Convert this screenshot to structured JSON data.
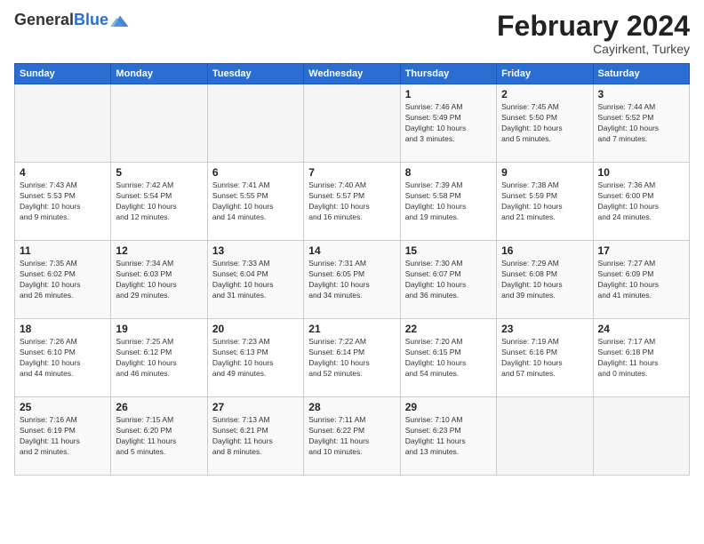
{
  "header": {
    "logo_general": "General",
    "logo_blue": "Blue",
    "month_title": "February 2024",
    "subtitle": "Cayirkent, Turkey"
  },
  "weekdays": [
    "Sunday",
    "Monday",
    "Tuesday",
    "Wednesday",
    "Thursday",
    "Friday",
    "Saturday"
  ],
  "rows": [
    [
      {
        "day": "",
        "info": ""
      },
      {
        "day": "",
        "info": ""
      },
      {
        "day": "",
        "info": ""
      },
      {
        "day": "",
        "info": ""
      },
      {
        "day": "1",
        "info": "Sunrise: 7:46 AM\nSunset: 5:49 PM\nDaylight: 10 hours\nand 3 minutes."
      },
      {
        "day": "2",
        "info": "Sunrise: 7:45 AM\nSunset: 5:50 PM\nDaylight: 10 hours\nand 5 minutes."
      },
      {
        "day": "3",
        "info": "Sunrise: 7:44 AM\nSunset: 5:52 PM\nDaylight: 10 hours\nand 7 minutes."
      }
    ],
    [
      {
        "day": "4",
        "info": "Sunrise: 7:43 AM\nSunset: 5:53 PM\nDaylight: 10 hours\nand 9 minutes."
      },
      {
        "day": "5",
        "info": "Sunrise: 7:42 AM\nSunset: 5:54 PM\nDaylight: 10 hours\nand 12 minutes."
      },
      {
        "day": "6",
        "info": "Sunrise: 7:41 AM\nSunset: 5:55 PM\nDaylight: 10 hours\nand 14 minutes."
      },
      {
        "day": "7",
        "info": "Sunrise: 7:40 AM\nSunset: 5:57 PM\nDaylight: 10 hours\nand 16 minutes."
      },
      {
        "day": "8",
        "info": "Sunrise: 7:39 AM\nSunset: 5:58 PM\nDaylight: 10 hours\nand 19 minutes."
      },
      {
        "day": "9",
        "info": "Sunrise: 7:38 AM\nSunset: 5:59 PM\nDaylight: 10 hours\nand 21 minutes."
      },
      {
        "day": "10",
        "info": "Sunrise: 7:36 AM\nSunset: 6:00 PM\nDaylight: 10 hours\nand 24 minutes."
      }
    ],
    [
      {
        "day": "11",
        "info": "Sunrise: 7:35 AM\nSunset: 6:02 PM\nDaylight: 10 hours\nand 26 minutes."
      },
      {
        "day": "12",
        "info": "Sunrise: 7:34 AM\nSunset: 6:03 PM\nDaylight: 10 hours\nand 29 minutes."
      },
      {
        "day": "13",
        "info": "Sunrise: 7:33 AM\nSunset: 6:04 PM\nDaylight: 10 hours\nand 31 minutes."
      },
      {
        "day": "14",
        "info": "Sunrise: 7:31 AM\nSunset: 6:05 PM\nDaylight: 10 hours\nand 34 minutes."
      },
      {
        "day": "15",
        "info": "Sunrise: 7:30 AM\nSunset: 6:07 PM\nDaylight: 10 hours\nand 36 minutes."
      },
      {
        "day": "16",
        "info": "Sunrise: 7:29 AM\nSunset: 6:08 PM\nDaylight: 10 hours\nand 39 minutes."
      },
      {
        "day": "17",
        "info": "Sunrise: 7:27 AM\nSunset: 6:09 PM\nDaylight: 10 hours\nand 41 minutes."
      }
    ],
    [
      {
        "day": "18",
        "info": "Sunrise: 7:26 AM\nSunset: 6:10 PM\nDaylight: 10 hours\nand 44 minutes."
      },
      {
        "day": "19",
        "info": "Sunrise: 7:25 AM\nSunset: 6:12 PM\nDaylight: 10 hours\nand 46 minutes."
      },
      {
        "day": "20",
        "info": "Sunrise: 7:23 AM\nSunset: 6:13 PM\nDaylight: 10 hours\nand 49 minutes."
      },
      {
        "day": "21",
        "info": "Sunrise: 7:22 AM\nSunset: 6:14 PM\nDaylight: 10 hours\nand 52 minutes."
      },
      {
        "day": "22",
        "info": "Sunrise: 7:20 AM\nSunset: 6:15 PM\nDaylight: 10 hours\nand 54 minutes."
      },
      {
        "day": "23",
        "info": "Sunrise: 7:19 AM\nSunset: 6:16 PM\nDaylight: 10 hours\nand 57 minutes."
      },
      {
        "day": "24",
        "info": "Sunrise: 7:17 AM\nSunset: 6:18 PM\nDaylight: 11 hours\nand 0 minutes."
      }
    ],
    [
      {
        "day": "25",
        "info": "Sunrise: 7:16 AM\nSunset: 6:19 PM\nDaylight: 11 hours\nand 2 minutes."
      },
      {
        "day": "26",
        "info": "Sunrise: 7:15 AM\nSunset: 6:20 PM\nDaylight: 11 hours\nand 5 minutes."
      },
      {
        "day": "27",
        "info": "Sunrise: 7:13 AM\nSunset: 6:21 PM\nDaylight: 11 hours\nand 8 minutes."
      },
      {
        "day": "28",
        "info": "Sunrise: 7:11 AM\nSunset: 6:22 PM\nDaylight: 11 hours\nand 10 minutes."
      },
      {
        "day": "29",
        "info": "Sunrise: 7:10 AM\nSunset: 6:23 PM\nDaylight: 11 hours\nand 13 minutes."
      },
      {
        "day": "",
        "info": ""
      },
      {
        "day": "",
        "info": ""
      }
    ]
  ]
}
